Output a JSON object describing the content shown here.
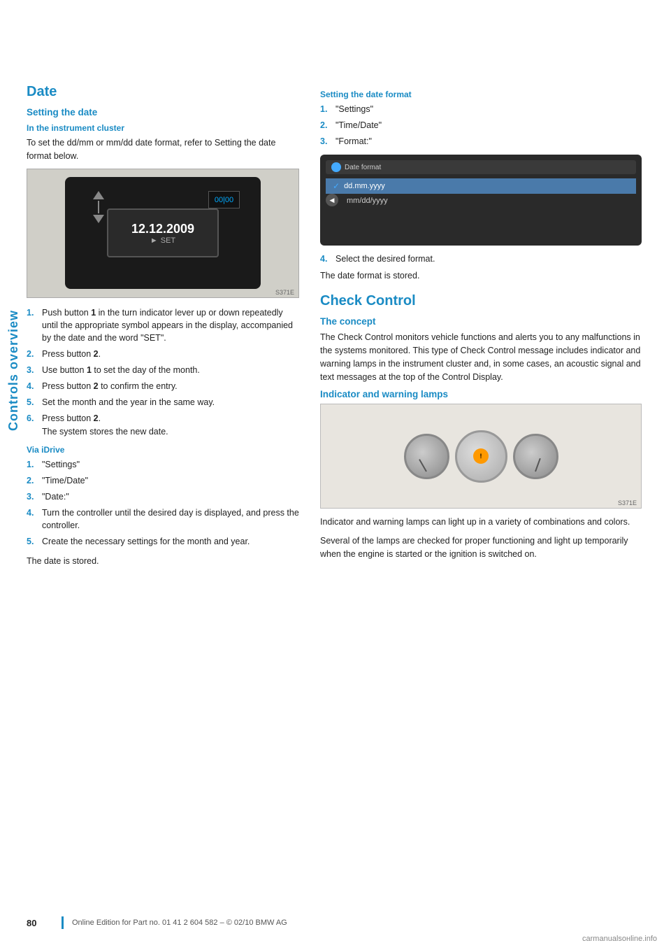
{
  "sidebar": {
    "label": "Controls overview"
  },
  "left_col": {
    "section_title": "Date",
    "setting_date_label": "Setting the date",
    "instrument_cluster_label": "In the instrument cluster",
    "instrument_cluster_text": "To set the dd/mm or mm/dd date format, refer to Setting the date format below.",
    "cluster_date": "12.12.2009",
    "cluster_set": "▶ SET",
    "steps_cluster": [
      {
        "num": "1.",
        "text": "Push button",
        "bold": "1",
        "text2": " in the turn indicator lever up or down repeatedly until the appropriate symbol appears in the display, accompanied by the date and the word \"SET\"."
      },
      {
        "num": "2.",
        "text": "Press button",
        "bold": "2",
        "text2": "."
      },
      {
        "num": "3.",
        "text": "Use button",
        "bold": "1",
        "text2": " to set the day of the month."
      },
      {
        "num": "4.",
        "text": "Press button",
        "bold": "2",
        "text2": " to confirm the entry."
      },
      {
        "num": "5.",
        "text": "Set the month and the year in the same way.",
        "bold": "",
        "text2": ""
      },
      {
        "num": "6.",
        "text": "Press button",
        "bold": "2",
        "text2": ".\nThe system stores the new date."
      }
    ],
    "via_idrive_label": "Via iDrive",
    "steps_idrive": [
      {
        "num": "1.",
        "text": "\"Settings\""
      },
      {
        "num": "2.",
        "text": "\"Time/Date\""
      },
      {
        "num": "3.",
        "text": "\"Date:\""
      },
      {
        "num": "4.",
        "text": "Turn the controller until the desired day is displayed, and press the controller."
      },
      {
        "num": "5.",
        "text": "Create the necessary settings for the month and year."
      }
    ],
    "date_stored_text": "The date is stored."
  },
  "right_col": {
    "setting_date_format_label": "Setting the date format",
    "steps_format": [
      {
        "num": "1.",
        "text": "\"Settings\""
      },
      {
        "num": "2.",
        "text": "\"Time/Date\""
      },
      {
        "num": "3.",
        "text": "\"Format:\""
      }
    ],
    "date_format_window_title": "Date format",
    "date_option_1": "✓ dd.mm.yyyy",
    "date_option_2": "mm/dd/yyyy",
    "step4_text": "Select the desired format.",
    "stored_text": "The date format is stored.",
    "check_control_title": "Check Control",
    "concept_label": "The concept",
    "concept_text": "The Check Control monitors vehicle functions and alerts you to any malfunctions in the systems monitored. This type of Check Control message includes indicator and warning lamps in the instrument cluster and, in some cases, an acoustic signal and text messages at the top of the Control Display.",
    "indicator_warning_label": "Indicator and warning lamps",
    "indicator_text_1": "Indicator and warning lamps can light up in a variety of combinations and colors.",
    "indicator_text_2": "Several of the lamps are checked for proper functioning and light up temporarily when the engine is started or the ignition is switched on."
  },
  "footer": {
    "page_number": "80",
    "footer_text": "Online Edition for Part no. 01 41 2 604 582 – © 02/10 BMW AG"
  },
  "watermark": {
    "text": "carmanualsонline.info"
  }
}
